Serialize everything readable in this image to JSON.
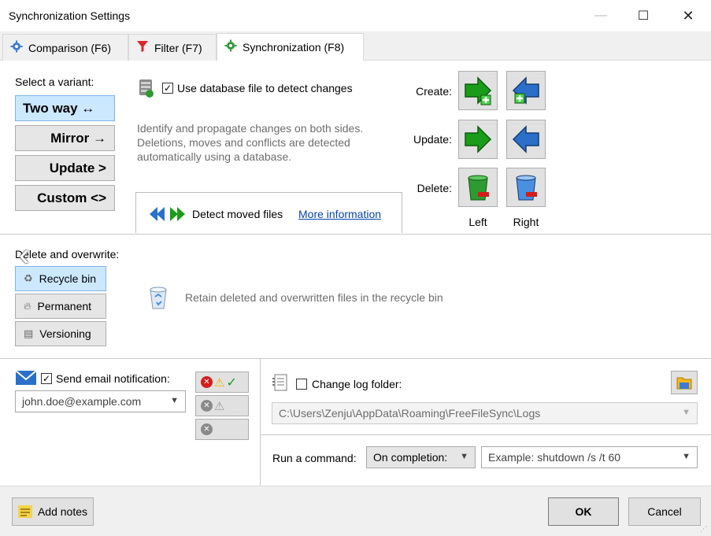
{
  "window": {
    "title": "Synchronization Settings",
    "minimize_glyph": "—",
    "maximize_glyph": "☐",
    "close_glyph": "✕"
  },
  "tabs": [
    {
      "label": "Comparison (F6)",
      "icon": "gear-icon"
    },
    {
      "label": "Filter (F7)",
      "icon": "funnel-icon"
    },
    {
      "label": "Synchronization (F8)",
      "icon": "gear-green-icon",
      "active": true
    }
  ],
  "variant": {
    "heading": "Select a variant:",
    "options": [
      {
        "label": "Two way ↔",
        "selected": true
      },
      {
        "label": "Mirror →"
      },
      {
        "label": "Update >"
      },
      {
        "label": "Custom <>"
      }
    ]
  },
  "database": {
    "checkbox_label": "Use database file to detect changes",
    "checked": true,
    "description": "Identify and propagate changes on both sides. Deletions, moves and conflicts are detected automatically using a database."
  },
  "moved_files": {
    "label": "Detect moved files",
    "link": "More information"
  },
  "actions": {
    "create_label": "Create:",
    "update_label": "Update:",
    "delete_label": "Delete:",
    "left_label": "Left",
    "right_label": "Right"
  },
  "deletion": {
    "heading": "Delete and overwrite:",
    "options": [
      {
        "label": "Recycle bin",
        "selected": true
      },
      {
        "label": "Permanent"
      },
      {
        "label": "Versioning"
      }
    ],
    "description": "Retain deleted and overwritten files in the recycle bin"
  },
  "email": {
    "checkbox_label": "Send email notification:",
    "checked": true,
    "address": "john.doe@example.com"
  },
  "log": {
    "checkbox_label": "Change log folder:",
    "checked": false,
    "path": "C:\\Users\\Zenju\\AppData\\Roaming\\FreeFileSync\\Logs"
  },
  "command": {
    "label": "Run a command:",
    "when": "On completion:",
    "placeholder": "Example: shutdown /s /t 60"
  },
  "footer": {
    "notes_label": "Add notes",
    "ok_label": "OK",
    "cancel_label": "Cancel"
  },
  "colors": {
    "selected_bg": "#cce8ff",
    "selected_border": "#7eb4ea",
    "green_arrow": "#1a9c1a",
    "blue_arrow": "#2a6fc9",
    "link": "#0645ad"
  }
}
